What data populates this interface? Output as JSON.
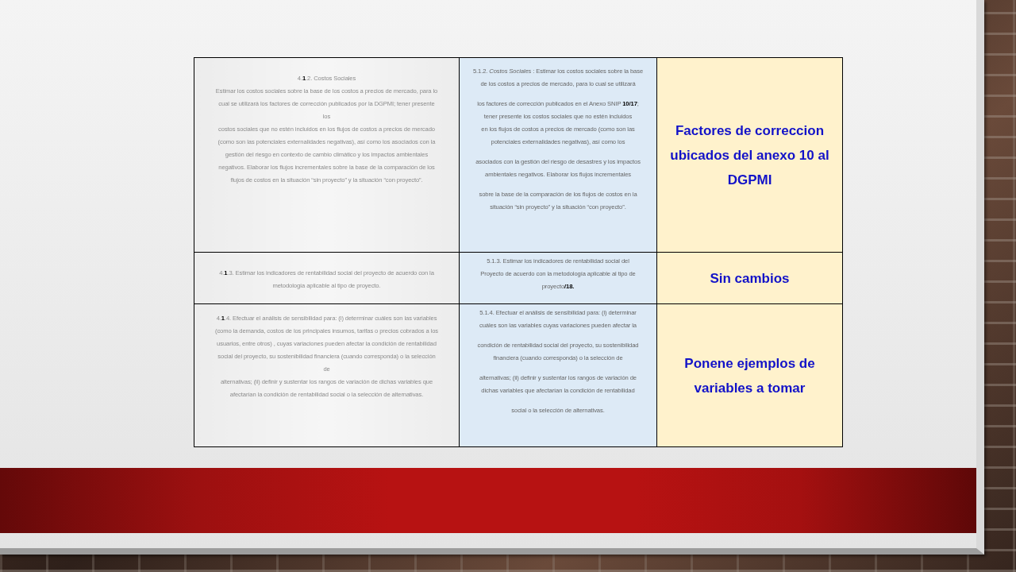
{
  "slide": {
    "table": {
      "rows": [
        {
          "column_1": [
            [
              "4.**1**.2. Costos Sociales"
            ],
            [
              "Estimar los costos sociales sobre la base de los costos a precios de mercado, para lo"
            ],
            [
              "cual se utilizará los factores de corrección publicados por la DGPMI; tener presente",
              "los"
            ],
            [
              "costos sociales que no estén incluidos en los flujos de costos a precios de mercado"
            ],
            [
              "(como son las potenciales externalidades negativas), así como los asociados con la"
            ],
            [
              "gestión del riesgo en contexto de cambio climático y los impactos ambientales",
              "negativos. Elaborar los flujos incrementales sobre la base de la comparación de los",
              "flujos de costos en la situación “sin proyecto” y la situación “con proyecto”."
            ]
          ],
          "column_2": [
            [
              "5.1.2. *Costos Sociales* : Estimar los costos sociales sobre la base",
              "de los costos a precios de mercado, para lo cual se utilizará"
            ],
            [
              "los factores de corrección publicados en el Anexo SNIP **10/17**;",
              "tener presente los costos sociales que no estén incluidos",
              "en los flujos de costos a precios de mercado (como son las",
              "potenciales externalidades negativas), así como los"
            ],
            [
              "asociados con la gestión del riesgo de desastres y los impactos",
              "ambientales negativos. Elaborar los flujos incrementales"
            ],
            [
              "sobre la base de la comparación de los flujos de costos en la",
              "situación “sin proyecto” y la situación “con proyecto”."
            ]
          ],
          "column_3": "Factores de correccion ubicados del anexo 10 al DGPMI"
        },
        {
          "column_1": [
            [
              "4.**1**.3. Estimar los indicadores de rentabilidad social del proyecto de acuerdo con la"
            ],
            [
              "metodología aplicable al tipo de proyecto."
            ]
          ],
          "column_2": [
            [
              "5.1.3. Estimar los indicadores de rentabilidad social del",
              "Proyecto de acuerdo con la metodología aplicable al tipo de",
              "proyecto**/18.**"
            ]
          ],
          "column_3": "Sin cambios"
        },
        {
          "column_1": [
            [
              "4.**1**.4. Efectuar el análisis de sensibilidad para: (i) determinar cuáles son las variables"
            ],
            [
              "(como la demanda, costos de los principales insumos, tarifas o precios cobrados a los"
            ],
            [
              "usuarios, entre otros) , cuyas variaciones pueden afectar la condición de rentabilidad"
            ],
            [
              "social del proyecto, su sostenibilidad financiera (cuando corresponda) o la selección",
              "de",
              "alternativas; (ii) definir y sustentar los rangos de variación de dichas variables que",
              "afectarían la condición de rentabilidad social o la selección de alternativas."
            ]
          ],
          "column_2": [
            [
              "5.1.4. Efectuar el análisis de sensibilidad para: (i) determinar",
              "cuáles son las variables cuyas variaciones pueden afectar la"
            ],
            [
              "condición de rentabilidad social del proyecto, su sostenibilidad",
              "financiera (cuando corresponda) o la selección de"
            ],
            [
              "alternativas; (ii) definir y sustentar los rangos de variación de",
              "dichas variables que afectarían la condición de rentabilidad"
            ],
            [
              "social o la selección de alternativas."
            ]
          ],
          "column_3": "Ponene ejemplos de variables a tomar"
        }
      ]
    }
  }
}
